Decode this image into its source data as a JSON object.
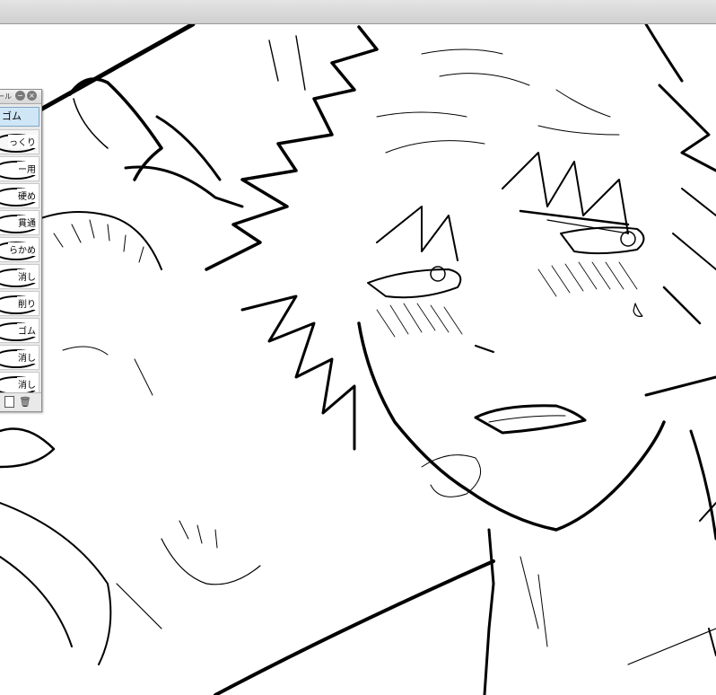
{
  "window": {
    "title": "ール"
  },
  "panel": {
    "header": "ゴム",
    "items": [
      {
        "label": "っくり"
      },
      {
        "label": "ー用"
      },
      {
        "label": "硬め"
      },
      {
        "label": "貫通"
      },
      {
        "label": "らかめ"
      },
      {
        "label": "消し"
      },
      {
        "label": "削り"
      },
      {
        "label": "ゴム"
      },
      {
        "label": "消し"
      },
      {
        "label": "消し"
      }
    ],
    "footer": {
      "new_icon": "new-page-icon",
      "delete_icon": "trash-icon"
    }
  }
}
